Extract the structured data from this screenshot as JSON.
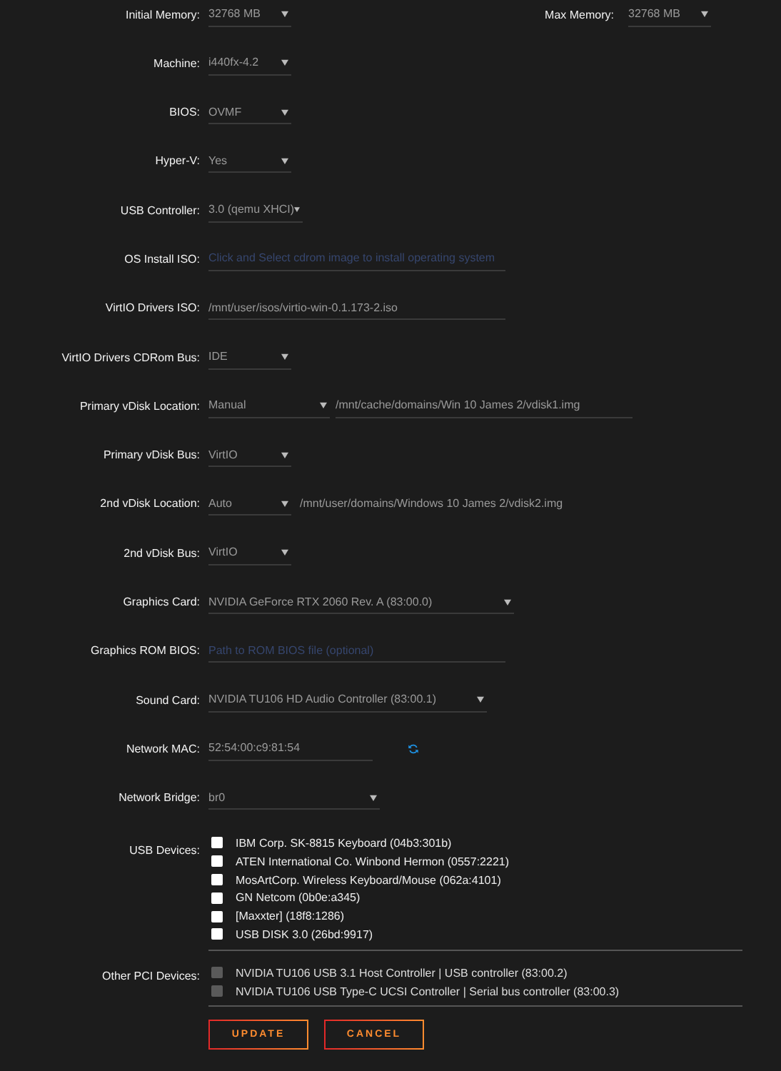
{
  "settings": [
    {
      "label": "Initial Memory:",
      "kind": "select",
      "value": "32768 MB",
      "pair": {
        "label": "Max Memory:",
        "value": "32768 MB"
      }
    },
    {
      "label": "Machine:",
      "kind": "select",
      "value": "i440fx-4.2"
    },
    {
      "label": "BIOS:",
      "kind": "select",
      "value": "OVMF"
    },
    {
      "label": "Hyper-V:",
      "kind": "select",
      "value": "Yes"
    },
    {
      "label": "USB Controller:",
      "kind": "select",
      "value": "3.0 (qemu XHCI)"
    },
    {
      "label": "OS Install ISO:",
      "kind": "input",
      "placeholder": "Click and Select cdrom image to install operating system"
    },
    {
      "label": "VirtIO Drivers ISO:",
      "kind": "input",
      "value": "/mnt/user/isos/virtio-win-0.1.173-2.iso"
    },
    {
      "label": "VirtIO Drivers CDRom Bus:",
      "kind": "select",
      "value": "IDE"
    },
    {
      "label": "Primary vDisk Location:",
      "kind": "select-input",
      "value": "Manual",
      "path": "/mnt/cache/domains/Win 10 James 2/vdisk1.img"
    },
    {
      "label": "Primary vDisk Bus:",
      "kind": "select",
      "value": "VirtIO"
    },
    {
      "label": "2nd vDisk Location:",
      "kind": "select-note",
      "value": "Auto",
      "path": "/mnt/user/domains/Windows 10 James 2/vdisk2.img"
    },
    {
      "label": "2nd vDisk Bus:",
      "kind": "select",
      "value": "VirtIO"
    },
    {
      "label": "Graphics Card:",
      "kind": "select",
      "value": "NVIDIA GeForce RTX 2060 Rev. A (83:00.0)"
    },
    {
      "label": "Graphics ROM BIOS:",
      "kind": "input",
      "placeholder": "Path to ROM BIOS file (optional)"
    },
    {
      "label": "Sound Card:",
      "kind": "select",
      "value": "NVIDIA TU106 HD Audio Controller (83:00.1)"
    },
    {
      "label": "Network MAC:",
      "kind": "mac",
      "value": "52:54:00:c9:81:54"
    },
    {
      "label": "Network Bridge:",
      "kind": "select",
      "value": "br0"
    }
  ],
  "device_groups": [
    {
      "label": "USB Devices:",
      "items": [
        {
          "name": "IBM Corp. SK-8815 Keyboard (04b3:301b)",
          "checked": false,
          "disabled": false
        },
        {
          "name": "ATEN International Co. Winbond Hermon (0557:2221)",
          "checked": false,
          "disabled": false
        },
        {
          "name": "MosArtCorp. Wireless Keyboard/Mouse (062a:4101)",
          "checked": false,
          "disabled": false
        },
        {
          "name": "GN Netcom (0b0e:a345)",
          "checked": false,
          "disabled": false
        },
        {
          "name": "[Maxxter] (18f8:1286)",
          "checked": false,
          "disabled": false
        },
        {
          "name": "USB DISK 3.0 (26bd:9917)",
          "checked": false,
          "disabled": false
        }
      ]
    },
    {
      "label": "Other PCI Devices:",
      "items": [
        {
          "name": "NVIDIA TU106 USB 3.1 Host Controller | USB controller (83:00.2)",
          "checked": false,
          "disabled": true
        },
        {
          "name": "NVIDIA TU106 USB Type-C UCSI Controller | Serial bus controller (83:00.3)",
          "checked": false,
          "disabled": true
        }
      ]
    }
  ],
  "buttons": [
    "UPDATE",
    "CANCEL"
  ]
}
